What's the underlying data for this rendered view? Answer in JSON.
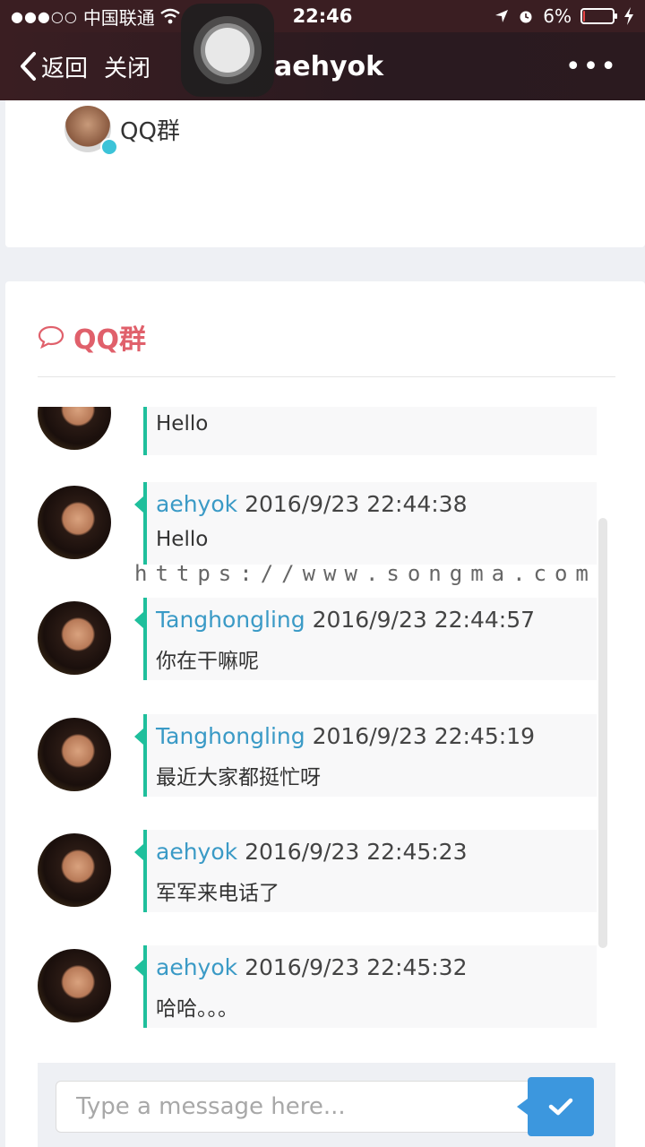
{
  "status_bar": {
    "signal": "●●●○○",
    "carrier": "中国联通",
    "time": "22:46",
    "battery_percent": "6%",
    "battery_level": 0.06
  },
  "nav": {
    "back_label": "返回",
    "close_label": "关闭",
    "title": "aehyok",
    "more_label": "•••"
  },
  "group": {
    "name": "QQ群"
  },
  "chat": {
    "title": "QQ群",
    "messages": [
      {
        "author": "",
        "time": "",
        "text": "Hello"
      },
      {
        "author": "aehyok",
        "time": "2016/9/23 22:44:38",
        "text": "Hello"
      },
      {
        "author": "Tanghongling",
        "time": "2016/9/23 22:44:57",
        "text": "你在干嘛呢"
      },
      {
        "author": "Tanghongling",
        "time": "2016/9/23 22:45:19",
        "text": "最近大家都挺忙呀"
      },
      {
        "author": "aehyok",
        "time": "2016/9/23 22:45:23",
        "text": "军军来电话了"
      },
      {
        "author": "aehyok",
        "time": "2016/9/23 22:45:32",
        "text": "哈哈。。。"
      }
    ]
  },
  "watermark": "https://www.songma.com",
  "composer": {
    "placeholder": "Type a message here..."
  },
  "colors": {
    "accent": "#e0606b",
    "author": "#3a9ac6",
    "bubble_border": "#1fbf9c",
    "send_button": "#3c97de"
  }
}
